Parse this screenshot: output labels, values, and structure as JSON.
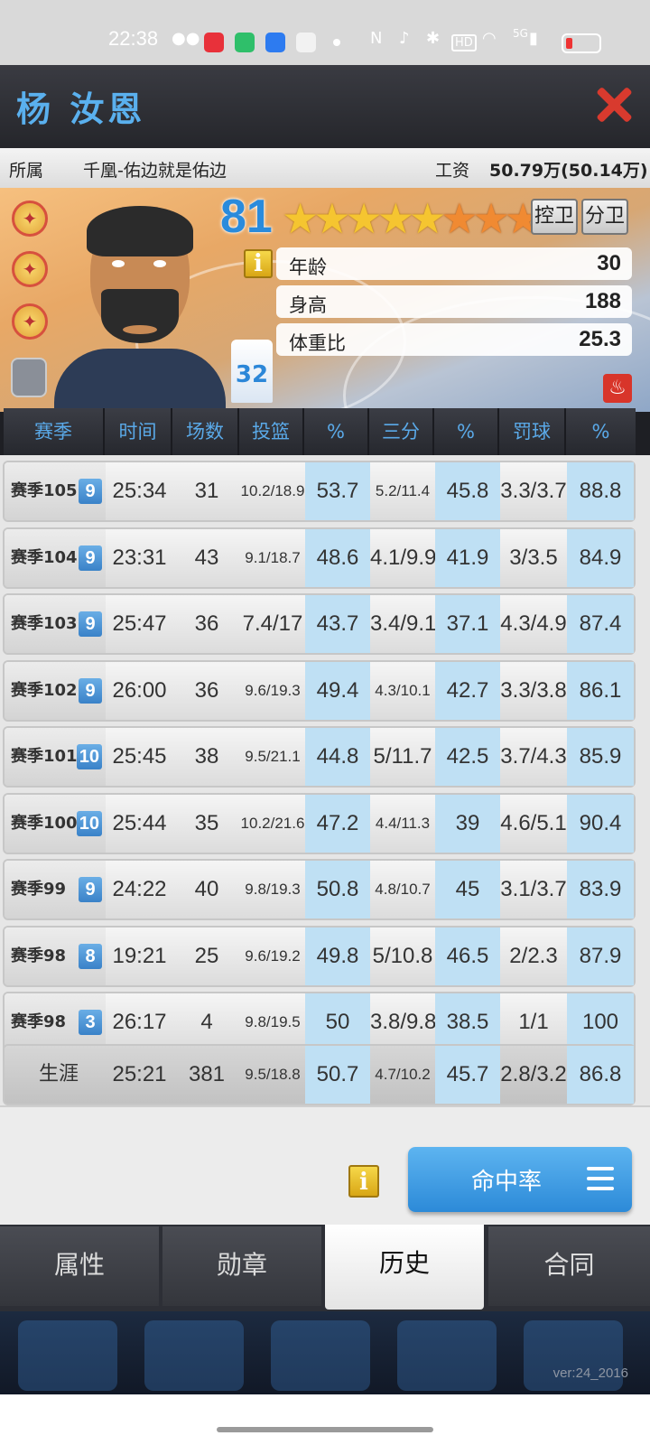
{
  "status_bar": {
    "time": "22:38",
    "network": "5G"
  },
  "header": {
    "player_name": "杨 汝恩"
  },
  "info": {
    "team_label": "所属",
    "team_value": "千凰-佑边就是佑边",
    "salary_label": "工资",
    "salary_value": "50.79万(50.14万)"
  },
  "card": {
    "overall": "81",
    "stars_total": 8,
    "stars_gold": 5,
    "jersey_number": "32",
    "positions": [
      "控卫",
      "分卫"
    ],
    "info_icon": "i",
    "attributes": [
      {
        "label": "年龄",
        "value": "30"
      },
      {
        "label": "身高",
        "value": "188"
      },
      {
        "label": "体重比",
        "value": "25.3"
      }
    ]
  },
  "table": {
    "headers": [
      "赛季",
      "时间",
      "场数",
      "投篮",
      "%",
      "三分",
      "%",
      "罚球",
      "%"
    ],
    "rows": [
      {
        "season": "赛季105",
        "lvl": "9",
        "time": "25:34",
        "games": "31",
        "fg": "10.2/18.9",
        "fg_pct": "53.7",
        "three": "5.2/11.4",
        "three_pct": "45.8",
        "ft": "3.3/3.7",
        "ft_pct": "88.8"
      },
      {
        "season": "赛季104",
        "lvl": "9",
        "time": "23:31",
        "games": "43",
        "fg": "9.1/18.7",
        "fg_pct": "48.6",
        "three": "4.1/9.9",
        "three_pct": "41.9",
        "ft": "3/3.5",
        "ft_pct": "84.9"
      },
      {
        "season": "赛季103",
        "lvl": "9",
        "time": "25:47",
        "games": "36",
        "fg": "7.4/17",
        "fg_pct": "43.7",
        "three": "3.4/9.1",
        "three_pct": "37.1",
        "ft": "4.3/4.9",
        "ft_pct": "87.4"
      },
      {
        "season": "赛季102",
        "lvl": "9",
        "time": "26:00",
        "games": "36",
        "fg": "9.6/19.3",
        "fg_pct": "49.4",
        "three": "4.3/10.1",
        "three_pct": "42.7",
        "ft": "3.3/3.8",
        "ft_pct": "86.1"
      },
      {
        "season": "赛季101",
        "lvl": "10",
        "time": "25:45",
        "games": "38",
        "fg": "9.5/21.1",
        "fg_pct": "44.8",
        "three": "5/11.7",
        "three_pct": "42.5",
        "ft": "3.7/4.3",
        "ft_pct": "85.9"
      },
      {
        "season": "赛季100",
        "lvl": "10",
        "time": "25:44",
        "games": "35",
        "fg": "10.2/21.6",
        "fg_pct": "47.2",
        "three": "4.4/11.3",
        "three_pct": "39",
        "ft": "4.6/5.1",
        "ft_pct": "90.4"
      },
      {
        "season": "赛季99",
        "lvl": "9",
        "time": "24:22",
        "games": "40",
        "fg": "9.8/19.3",
        "fg_pct": "50.8",
        "three": "4.8/10.7",
        "three_pct": "45",
        "ft": "3.1/3.7",
        "ft_pct": "83.9"
      },
      {
        "season": "赛季98",
        "lvl": "8",
        "time": "19:21",
        "games": "25",
        "fg": "9.6/19.2",
        "fg_pct": "49.8",
        "three": "5/10.8",
        "three_pct": "46.5",
        "ft": "2/2.3",
        "ft_pct": "87.9"
      },
      {
        "season": "赛季98",
        "lvl": "3",
        "time": "26:17",
        "games": "4",
        "fg": "9.8/19.5",
        "fg_pct": "50",
        "three": "3.8/9.8",
        "three_pct": "38.5",
        "ft": "1/1",
        "ft_pct": "100"
      }
    ],
    "career": {
      "season": "生涯",
      "time": "25:21",
      "games": "381",
      "fg": "9.5/18.8",
      "fg_pct": "50.7",
      "three": "4.7/10.2",
      "three_pct": "45.7",
      "ft": "2.8/3.2",
      "ft_pct": "86.8"
    }
  },
  "stat_mode_button": {
    "label": "命中率"
  },
  "tabs": [
    {
      "label": "属性",
      "active": false
    },
    {
      "label": "勋章",
      "active": false
    },
    {
      "label": "历史",
      "active": true
    },
    {
      "label": "合同",
      "active": false
    }
  ],
  "version": "ver:24_2016",
  "colors": {
    "accent_blue": "#2c8ad8",
    "highlight_cell": "#bfe0f4",
    "close_red": "#d83a2e",
    "star_gold": "#f5c530",
    "star_orange": "#f08a32"
  },
  "icons": [
    "wechat-icon",
    "app-icons",
    "nfc-icon",
    "mute-icon",
    "bluetooth-icon",
    "hd-icon",
    "wifi-icon",
    "signal-icon",
    "battery-icon",
    "close-icon",
    "badge-icon",
    "lock-icon",
    "info-icon",
    "fire-icon",
    "menu-icon"
  ]
}
